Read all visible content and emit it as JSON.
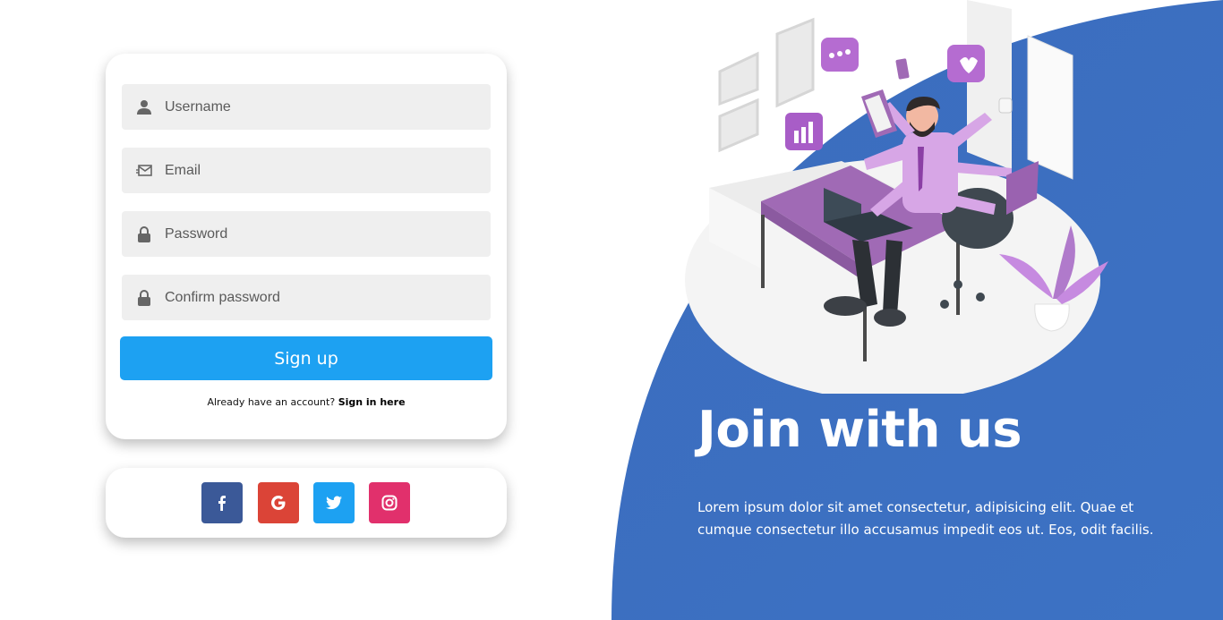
{
  "form": {
    "username_placeholder": "Username",
    "email_placeholder": "Email",
    "password_placeholder": "Password",
    "confirm_password_placeholder": "Confirm password",
    "signup_label": "Sign up",
    "signin_prompt": "Already have an account?",
    "signin_link": "Sign in here"
  },
  "social": {
    "facebook": {
      "icon": "facebook-icon",
      "color": "#3b5998"
    },
    "google": {
      "icon": "google-icon",
      "color": "#db4437"
    },
    "twitter": {
      "icon": "twitter-icon",
      "color": "#1da1f2"
    },
    "instagram": {
      "icon": "instagram-icon",
      "color": "#e1306c"
    }
  },
  "hero": {
    "title": "Join with us",
    "text": "Lorem ipsum dolor sit amet consectetur, adipisicing elit. Quae et cumque consectetur illo accusamus impedit eos ut. Eos, odit facilis."
  },
  "colors": {
    "accent": "#1da1f2",
    "panel_blue": "#3b6fc0"
  }
}
